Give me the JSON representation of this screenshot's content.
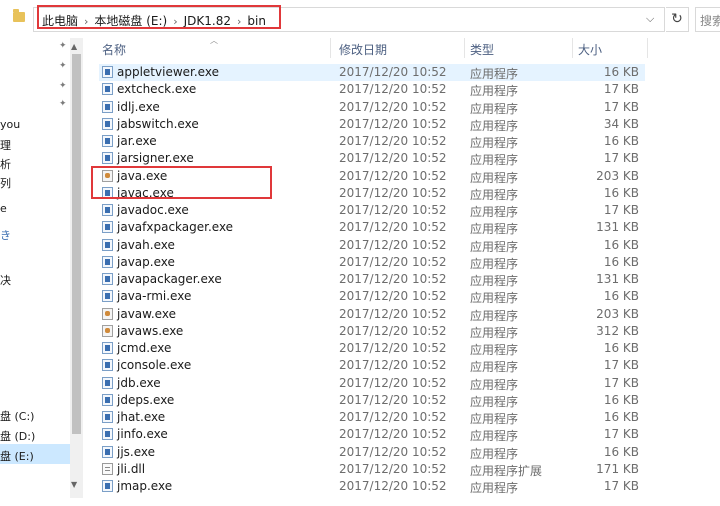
{
  "address_bar": {
    "crumbs": [
      "此电脑",
      "本地磁盘 (E:)",
      "JDK1.82",
      "bin"
    ],
    "separator": "›",
    "dropdown_glyph": "⌵",
    "refresh_glyph": "↻",
    "search_placeholder": "搜索"
  },
  "nav_pane": {
    "items": [
      "you",
      "理",
      "析",
      "列",
      "e",
      "き",
      "决",
      "盘 (C:)",
      "盘 (D:)",
      "盘 (E:)"
    ],
    "selected_index": 9
  },
  "columns": {
    "name": "名称",
    "date": "修改日期",
    "type": "类型",
    "size": "大小"
  },
  "files": [
    {
      "name": "appletviewer.exe",
      "date": "2017/12/20 10:52",
      "type": "应用程序",
      "size": "16 KB",
      "icon": "exe"
    },
    {
      "name": "extcheck.exe",
      "date": "2017/12/20 10:52",
      "type": "应用程序",
      "size": "17 KB",
      "icon": "exe"
    },
    {
      "name": "idlj.exe",
      "date": "2017/12/20 10:52",
      "type": "应用程序",
      "size": "17 KB",
      "icon": "exe"
    },
    {
      "name": "jabswitch.exe",
      "date": "2017/12/20 10:52",
      "type": "应用程序",
      "size": "34 KB",
      "icon": "exe"
    },
    {
      "name": "jar.exe",
      "date": "2017/12/20 10:52",
      "type": "应用程序",
      "size": "16 KB",
      "icon": "exe"
    },
    {
      "name": "jarsigner.exe",
      "date": "2017/12/20 10:52",
      "type": "应用程序",
      "size": "17 KB",
      "icon": "exe"
    },
    {
      "name": "java.exe",
      "date": "2017/12/20 10:52",
      "type": "应用程序",
      "size": "203 KB",
      "icon": "java"
    },
    {
      "name": "javac.exe",
      "date": "2017/12/20 10:52",
      "type": "应用程序",
      "size": "16 KB",
      "icon": "exe"
    },
    {
      "name": "javadoc.exe",
      "date": "2017/12/20 10:52",
      "type": "应用程序",
      "size": "17 KB",
      "icon": "exe"
    },
    {
      "name": "javafxpackager.exe",
      "date": "2017/12/20 10:52",
      "type": "应用程序",
      "size": "131 KB",
      "icon": "exe"
    },
    {
      "name": "javah.exe",
      "date": "2017/12/20 10:52",
      "type": "应用程序",
      "size": "16 KB",
      "icon": "exe"
    },
    {
      "name": "javap.exe",
      "date": "2017/12/20 10:52",
      "type": "应用程序",
      "size": "16 KB",
      "icon": "exe"
    },
    {
      "name": "javapackager.exe",
      "date": "2017/12/20 10:52",
      "type": "应用程序",
      "size": "131 KB",
      "icon": "exe"
    },
    {
      "name": "java-rmi.exe",
      "date": "2017/12/20 10:52",
      "type": "应用程序",
      "size": "16 KB",
      "icon": "exe"
    },
    {
      "name": "javaw.exe",
      "date": "2017/12/20 10:52",
      "type": "应用程序",
      "size": "203 KB",
      "icon": "java"
    },
    {
      "name": "javaws.exe",
      "date": "2017/12/20 10:52",
      "type": "应用程序",
      "size": "312 KB",
      "icon": "java"
    },
    {
      "name": "jcmd.exe",
      "date": "2017/12/20 10:52",
      "type": "应用程序",
      "size": "16 KB",
      "icon": "exe"
    },
    {
      "name": "jconsole.exe",
      "date": "2017/12/20 10:52",
      "type": "应用程序",
      "size": "17 KB",
      "icon": "exe"
    },
    {
      "name": "jdb.exe",
      "date": "2017/12/20 10:52",
      "type": "应用程序",
      "size": "17 KB",
      "icon": "exe"
    },
    {
      "name": "jdeps.exe",
      "date": "2017/12/20 10:52",
      "type": "应用程序",
      "size": "16 KB",
      "icon": "exe"
    },
    {
      "name": "jhat.exe",
      "date": "2017/12/20 10:52",
      "type": "应用程序",
      "size": "16 KB",
      "icon": "exe"
    },
    {
      "name": "jinfo.exe",
      "date": "2017/12/20 10:52",
      "type": "应用程序",
      "size": "17 KB",
      "icon": "exe"
    },
    {
      "name": "jjs.exe",
      "date": "2017/12/20 10:52",
      "type": "应用程序",
      "size": "16 KB",
      "icon": "exe"
    },
    {
      "name": "jli.dll",
      "date": "2017/12/20 10:52",
      "type": "应用程序扩展",
      "size": "171 KB",
      "icon": "dll"
    },
    {
      "name": "jmap.exe",
      "date": "2017/12/20 10:52",
      "type": "应用程序",
      "size": "17 KB",
      "icon": "exe"
    }
  ],
  "colors": {
    "highlight_border": "#e0383a",
    "selection": "#cce8ff",
    "hover_row": "#e5f3ff"
  }
}
